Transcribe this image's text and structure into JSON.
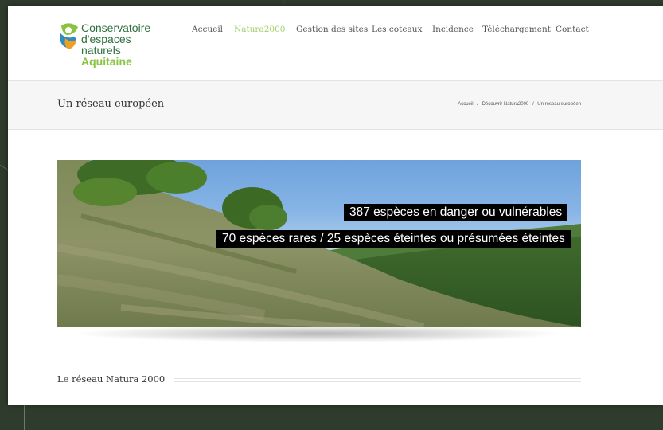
{
  "logo": {
    "line1": "Conservatoire",
    "line2": "d'espaces naturels",
    "line3": "Aquitaine"
  },
  "nav": {
    "items": [
      {
        "label": "Accueil",
        "active": false
      },
      {
        "label": "Natura2000",
        "active": true
      },
      {
        "label": "Gestion des sites",
        "active": false
      },
      {
        "label": "Les coteaux",
        "active": false
      },
      {
        "label": "Incidence",
        "active": false
      },
      {
        "label": "Téléchargement",
        "active": false
      },
      {
        "label": "Contact",
        "active": false
      }
    ]
  },
  "titlebar": {
    "title": "Un réseau européen",
    "breadcrumb": [
      "Accueil",
      "Découvrir Natura2000",
      "Un réseau européen"
    ],
    "separator": "/"
  },
  "banner": {
    "caption1": "387 espèces en danger ou vulnérables",
    "caption2": "70 espèces rares / 25 espèces éteintes ou présumées éteintes"
  },
  "section": {
    "title": "Le réseau Natura 2000"
  },
  "colors": {
    "accent": "#a6cf6a",
    "logo_dark": "#2e6f3e",
    "logo_light": "#8ac33f"
  }
}
